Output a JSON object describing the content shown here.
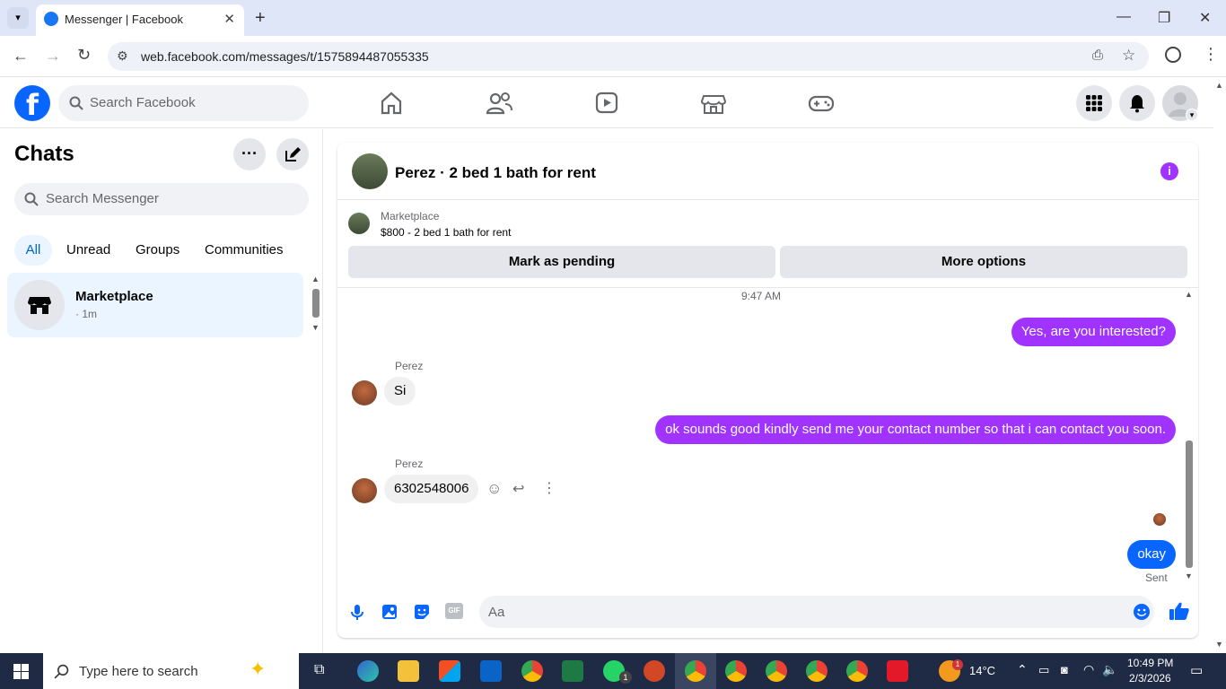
{
  "browser": {
    "tab_title": "Messenger | Facebook",
    "url": "web.facebook.com/messages/t/1575894487055335"
  },
  "facebook": {
    "search_placeholder": "Search Facebook"
  },
  "chats": {
    "title": "Chats",
    "search_placeholder": "Search Messenger",
    "filters": [
      "All",
      "Unread",
      "Groups",
      "Communities"
    ],
    "items": [
      {
        "name": "Marketplace",
        "time": "· 1m"
      }
    ]
  },
  "conversation": {
    "title": "Perez · 2 bed 1 bath for rent",
    "marketplace_label": "Marketplace",
    "listing": "$800 - 2 bed 1 bath for rent",
    "mark_pending": "Mark as pending",
    "more_options": "More options",
    "timestamp": "9:47 AM",
    "messages": [
      {
        "from": "me",
        "text": "Yes, are you interested?"
      },
      {
        "from": "Perez",
        "text": "Si"
      },
      {
        "from": "me",
        "text": "ok sounds good kindly  send me your contact number so that i can contact you soon."
      },
      {
        "from": "Perez",
        "text": "6302548006"
      },
      {
        "from": "me",
        "text": "okay"
      }
    ],
    "sender_name": "Perez",
    "status": "Sent",
    "input_placeholder": "Aa"
  },
  "taskbar": {
    "search_placeholder": "Type here to search",
    "weather": "14°C",
    "time": "10:49 PM",
    "date": "2/3/2026",
    "whatsapp_badge": "1",
    "weather_badge": "1"
  },
  "colors": {
    "fb_blue": "#0866ff",
    "messenger_purple": "#a033ff",
    "chat_selected": "#ebf5ff"
  }
}
